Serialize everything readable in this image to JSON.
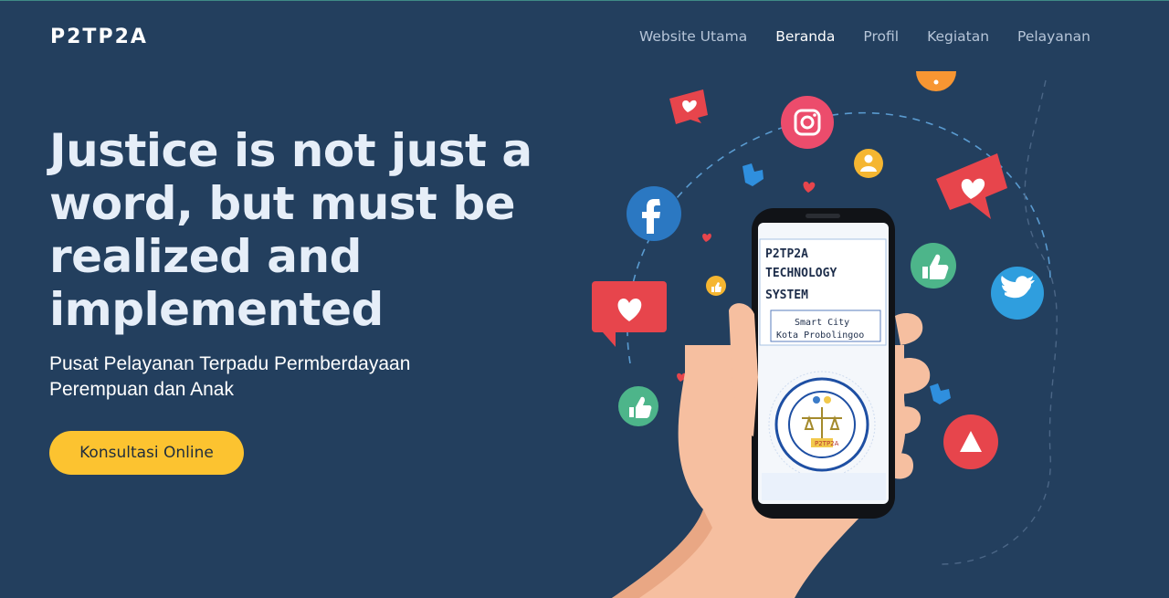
{
  "header": {
    "logo": "P2TP2A",
    "nav": [
      {
        "label": "Website Utama",
        "active": false
      },
      {
        "label": "Beranda",
        "active": true
      },
      {
        "label": "Profil",
        "active": false
      },
      {
        "label": "Kegiatan",
        "active": false
      },
      {
        "label": "Pelayanan",
        "active": false
      }
    ]
  },
  "hero": {
    "title": "Justice is not just a word, but must be realized and implemented",
    "subtitle": "Pusat Pelayanan Terpadu Permberdayaan Perempuan dan Anak",
    "cta_label": "Konsultasi Online"
  },
  "phone_screen": {
    "line1": "P2TP2A",
    "line2": "TECHNOLOGY",
    "line3": "SYSTEM",
    "city1": "Smart City",
    "city2": "Kota Probolingoo",
    "seal_badge": "P2TP2A"
  },
  "colors": {
    "background": "#233f5e",
    "accent": "#fcc330",
    "nav_text": "#b6c5d8"
  },
  "icons": [
    "facebook-icon",
    "instagram-icon",
    "twitter-icon",
    "youtube-icon",
    "like-icon",
    "heart-icon",
    "user-icon",
    "share-icon"
  ]
}
